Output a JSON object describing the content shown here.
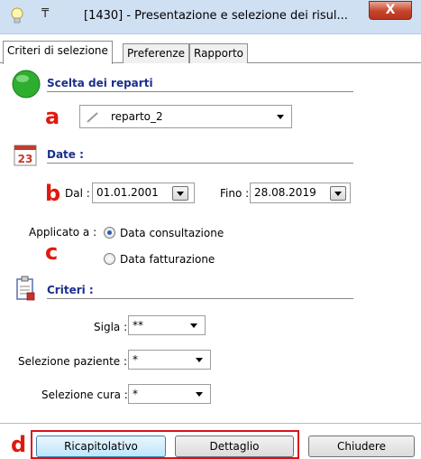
{
  "window": {
    "pin_glyph": "₸",
    "title": "[1430] - Presentazione e selezione dei risul...",
    "close_label": "X"
  },
  "tabs": [
    {
      "label": "Criteri di selezione",
      "active": true
    },
    {
      "label": "Preferenze",
      "active": false
    },
    {
      "label": "Rapporto",
      "active": false
    }
  ],
  "annotations": {
    "a": "a",
    "b": "b",
    "c": "c",
    "d": "d"
  },
  "reparti": {
    "title": "Scelta dei reparti",
    "selected": "reparto_2"
  },
  "date": {
    "title": "Date :",
    "calendar_number": "23",
    "dal_label": "Dal :",
    "dal_value": "01.01.2001",
    "fino_label": "Fino :",
    "fino_value": "28.08.2019"
  },
  "applicato": {
    "label": "Applicato a :",
    "options": [
      {
        "label": "Data consultazione",
        "checked": true
      },
      {
        "label": "Data fatturazione",
        "checked": false
      }
    ]
  },
  "criteri": {
    "title": "Criteri :",
    "sigla_label": "Sigla :",
    "sigla_value": "**",
    "paziente_label": "Selezione paziente :",
    "paziente_value": "*",
    "cura_label": "Selezione cura :",
    "cura_value": "*"
  },
  "buttons": {
    "ricapitolativo": "Ricapitolativo",
    "dettaglio": "Dettaglio",
    "chiudere": "Chiudere"
  },
  "colors": {
    "section_title": "#1b2f8c",
    "annotation_red": "#e0190f"
  }
}
